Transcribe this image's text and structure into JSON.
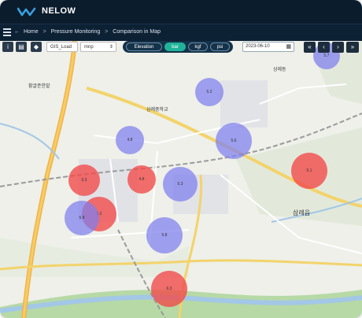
{
  "app": {
    "brand": "NELOW"
  },
  "breadcrumb": {
    "home": "Home",
    "items": [
      "Pressure Monitoring",
      "Comparison in Map"
    ]
  },
  "toolbar": {
    "layer_select": "GIS_Load",
    "unit_select": "mnp",
    "elevation_label": "Elevation",
    "units": [
      "bar",
      "kgf",
      "psi"
    ],
    "active_unit": "bar",
    "date": "2023-06-10"
  },
  "map": {
    "labels": [
      "황굴준한밭",
      "상례동",
      "삼례중학교",
      "삼례읍"
    ],
    "markers": [
      {
        "color": "red",
        "value": "5.3"
      },
      {
        "color": "red",
        "value": "4.8"
      },
      {
        "color": "red",
        "value": "6.2"
      },
      {
        "color": "red",
        "value": "5.1"
      },
      {
        "color": "red",
        "value": "6.3"
      },
      {
        "color": "blue",
        "value": "5.7"
      },
      {
        "color": "blue",
        "value": "5.2"
      },
      {
        "color": "blue",
        "value": "4.8"
      },
      {
        "color": "blue",
        "value": "5.6"
      },
      {
        "color": "blue",
        "value": "6.3"
      },
      {
        "color": "blue",
        "value": "5.8"
      },
      {
        "color": "blue",
        "value": "5.8"
      }
    ]
  },
  "colors": {
    "header_bg": "#0b1c2c",
    "active_unit": "#21b39a",
    "high_pressure": "#f24848",
    "normal_pressure": "#7e7eee"
  },
  "icons": [
    "info-icon",
    "layers-icon",
    "tag-icon",
    "calendar-icon"
  ]
}
